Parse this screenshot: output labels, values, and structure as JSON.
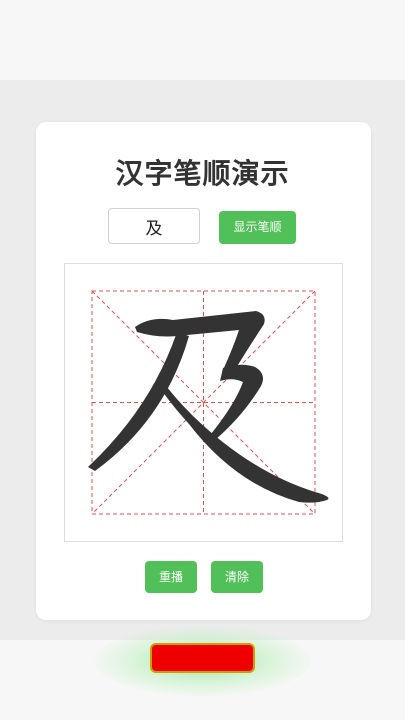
{
  "app": {
    "title": "汉字笔顺演示"
  },
  "controls": {
    "character_value": "及",
    "show_button_label": "显示笔顺"
  },
  "playback": {
    "replay_label": "重播",
    "clear_label": "清除"
  },
  "colors": {
    "accent_green": "#52c059",
    "guide_red": "#d9534f",
    "stroke_dark": "#333333",
    "bottom_bar": "#ee0000"
  },
  "icons": {
    "grid": "tianzige-guide-grid"
  }
}
